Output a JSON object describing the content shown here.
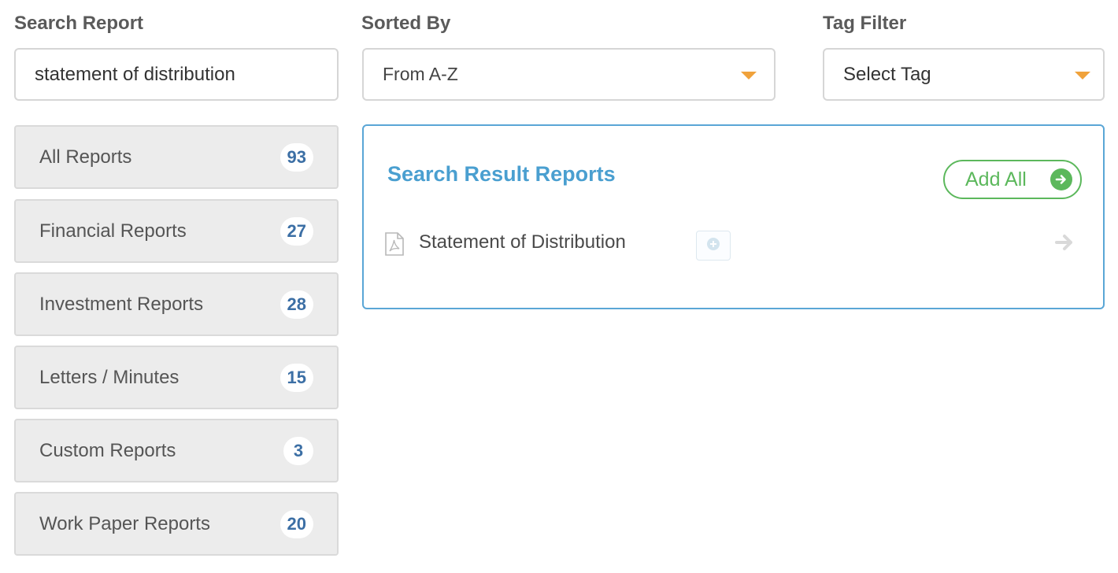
{
  "search": {
    "label": "Search Report",
    "value": "statement of distribution"
  },
  "sort": {
    "label": "Sorted By",
    "selected": "From A-Z"
  },
  "tag_filter": {
    "label": "Tag Filter",
    "selected": "Select Tag"
  },
  "categories": [
    {
      "label": "All Reports",
      "count": "93"
    },
    {
      "label": "Financial Reports",
      "count": "27"
    },
    {
      "label": "Investment Reports",
      "count": "28"
    },
    {
      "label": "Letters / Minutes",
      "count": "15"
    },
    {
      "label": "Custom Reports",
      "count": "3"
    },
    {
      "label": "Work Paper Reports",
      "count": "20"
    }
  ],
  "results": {
    "title": "Search Result Reports",
    "add_all_label": "Add All",
    "items": [
      {
        "name": "Statement of Distribution",
        "icon": "pdf-file-icon"
      }
    ]
  },
  "colors": {
    "accent_blue": "#4a9fd0",
    "green": "#5cb85c",
    "caret_orange": "#f0a23b",
    "badge_blue": "#3c6fa5"
  }
}
